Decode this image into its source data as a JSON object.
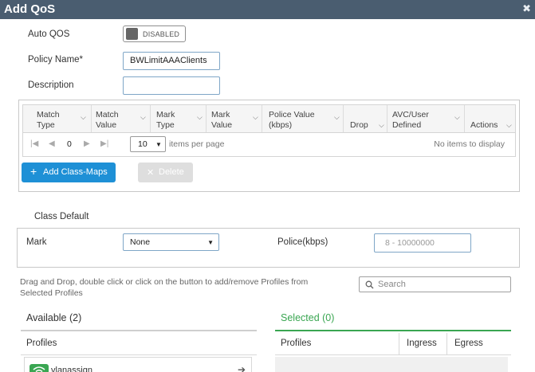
{
  "dialog": {
    "title": "Add QoS",
    "close_icon": "close-icon"
  },
  "form": {
    "auto_qos_label": "Auto QOS",
    "auto_qos_state": "DISABLED",
    "policy_name_label": "Policy Name*",
    "policy_name_value": "BWLimitAAAClients",
    "description_label": "Description",
    "description_value": ""
  },
  "class_maps": {
    "columns": [
      {
        "line1": "Match",
        "line2": "Type"
      },
      {
        "line1": "Match",
        "line2": "Value"
      },
      {
        "line1": "Mark",
        "line2": "Type"
      },
      {
        "line1": "Mark",
        "line2": "Value"
      },
      {
        "line1": "Police Value",
        "line2": "(kbps)"
      },
      {
        "line1": "",
        "line2": "Drop"
      },
      {
        "line1": "AVC/User",
        "line2": "Defined"
      },
      {
        "line1": "",
        "line2": "Actions"
      }
    ],
    "page_number": "0",
    "page_size": "10",
    "items_per_page": "items per page",
    "empty_text": "No items to display",
    "add_button": "Add Class-Maps",
    "delete_button": "Delete"
  },
  "class_default": {
    "title": "Class Default",
    "mark_label": "Mark",
    "mark_value": "None",
    "police_label": "Police(kbps)",
    "police_placeholder": "8 - 10000000"
  },
  "profiles": {
    "hint_line1": "Drag and Drop, double click or click on the button to add/remove Profiles from",
    "hint_line2": "Selected Profiles",
    "search_placeholder": "Search",
    "available_title": "Available (2)",
    "selected_title": "Selected (0)",
    "available_header": "Profiles",
    "selected_headers": [
      "Profiles",
      "Ingress",
      "Egress"
    ],
    "available_items": [
      {
        "name": "vlanassign",
        "icon": "wifi-icon"
      }
    ]
  },
  "colors": {
    "titlebar": "#4a5d70",
    "primary": "#1e90d6",
    "selected_accent": "#3aa652"
  }
}
